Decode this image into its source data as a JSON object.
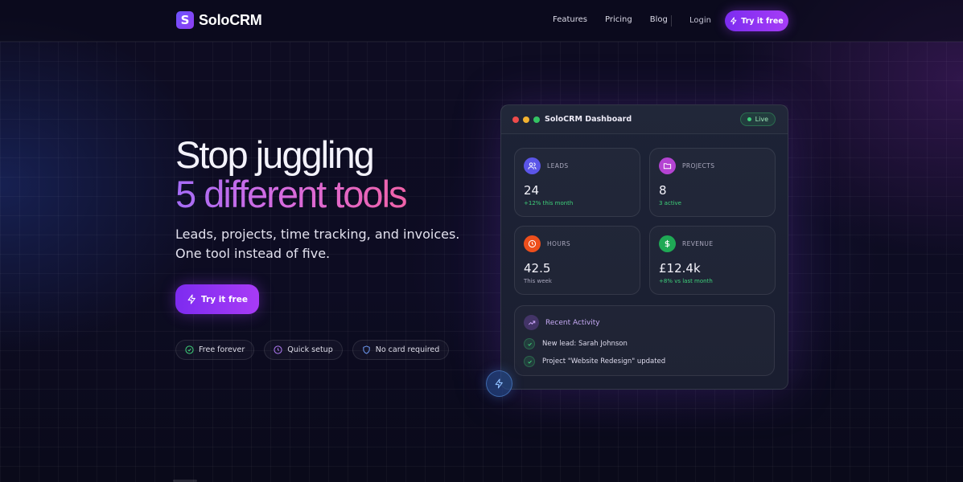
{
  "brand": {
    "name": "SoloCRM",
    "mark": "S"
  },
  "nav": {
    "links": [
      "Features",
      "Pricing",
      "Blog"
    ],
    "login": "Login",
    "cta": "Try it free"
  },
  "hero": {
    "title_line1": "Stop juggling",
    "title_line2": "5 different tools",
    "subtitle": "Leads, projects, time tracking, and invoices. One tool instead of five.",
    "cta": "Try it free",
    "badges": [
      "Free forever",
      "Quick setup",
      "No card required"
    ]
  },
  "dashboard": {
    "title": "SoloCRM Dashboard",
    "status": "Live",
    "cards": [
      {
        "label": "LEADS",
        "value": "24",
        "note": "+12% this month",
        "icon": "users-icon"
      },
      {
        "label": "PROJECTS",
        "value": "8",
        "note": "3 active",
        "icon": "folder-icon"
      },
      {
        "label": "HOURS",
        "value": "42.5",
        "note": "This week",
        "icon": "clock-icon"
      },
      {
        "label": "REVENUE",
        "value": "£12.4k",
        "note": "+8% vs last month",
        "icon": "dollar-icon"
      }
    ],
    "activity": {
      "title": "Recent Activity",
      "items": [
        "New lead: Sarah Johnson",
        "Project \"Website Redesign\" updated"
      ]
    }
  },
  "colors": {
    "accent": "#8b34f3",
    "live_green": "#3ed17a",
    "leads_icon": "#6a5cf6",
    "projects_icon": "#c04ad8",
    "hours_icon": "#f0541e",
    "revenue_icon": "#22b25c"
  }
}
